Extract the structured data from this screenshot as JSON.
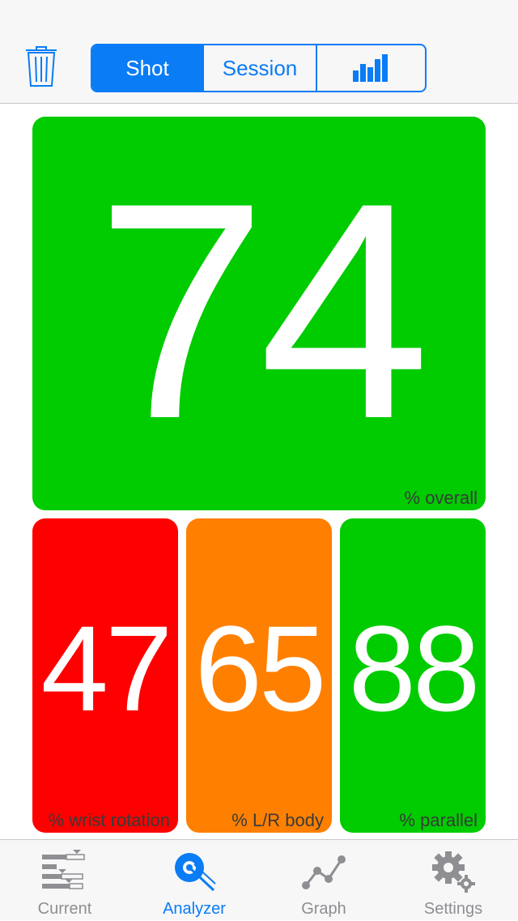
{
  "colors": {
    "accent": "#0a7cf5",
    "good": "#00cc00",
    "bad": "#ff0000",
    "medium": "#ff8000",
    "label": "#3a3a3a",
    "tab_inactive": "#8e8e93"
  },
  "navbar": {
    "trash_icon": "trash-icon",
    "segments": [
      {
        "label": "Shot",
        "selected": true
      },
      {
        "label": "Session",
        "selected": false
      },
      {
        "label": "",
        "icon": "bar-chart-icon",
        "selected": false
      }
    ]
  },
  "scores": {
    "overall": {
      "value": "74",
      "label": "% overall"
    },
    "wrist": {
      "value": "47",
      "label": "% wrist rotation"
    },
    "body": {
      "value": "65",
      "label": "% L/R body"
    },
    "parallel": {
      "value": "88",
      "label": "% parallel"
    }
  },
  "tabbar": {
    "tabs": [
      {
        "label": "Current",
        "icon": "current-icon",
        "active": false
      },
      {
        "label": "Analyzer",
        "icon": "analyzer-icon",
        "active": true
      },
      {
        "label": "Graph",
        "icon": "graph-icon",
        "active": false
      },
      {
        "label": "Settings",
        "icon": "settings-icon",
        "active": false
      }
    ]
  }
}
